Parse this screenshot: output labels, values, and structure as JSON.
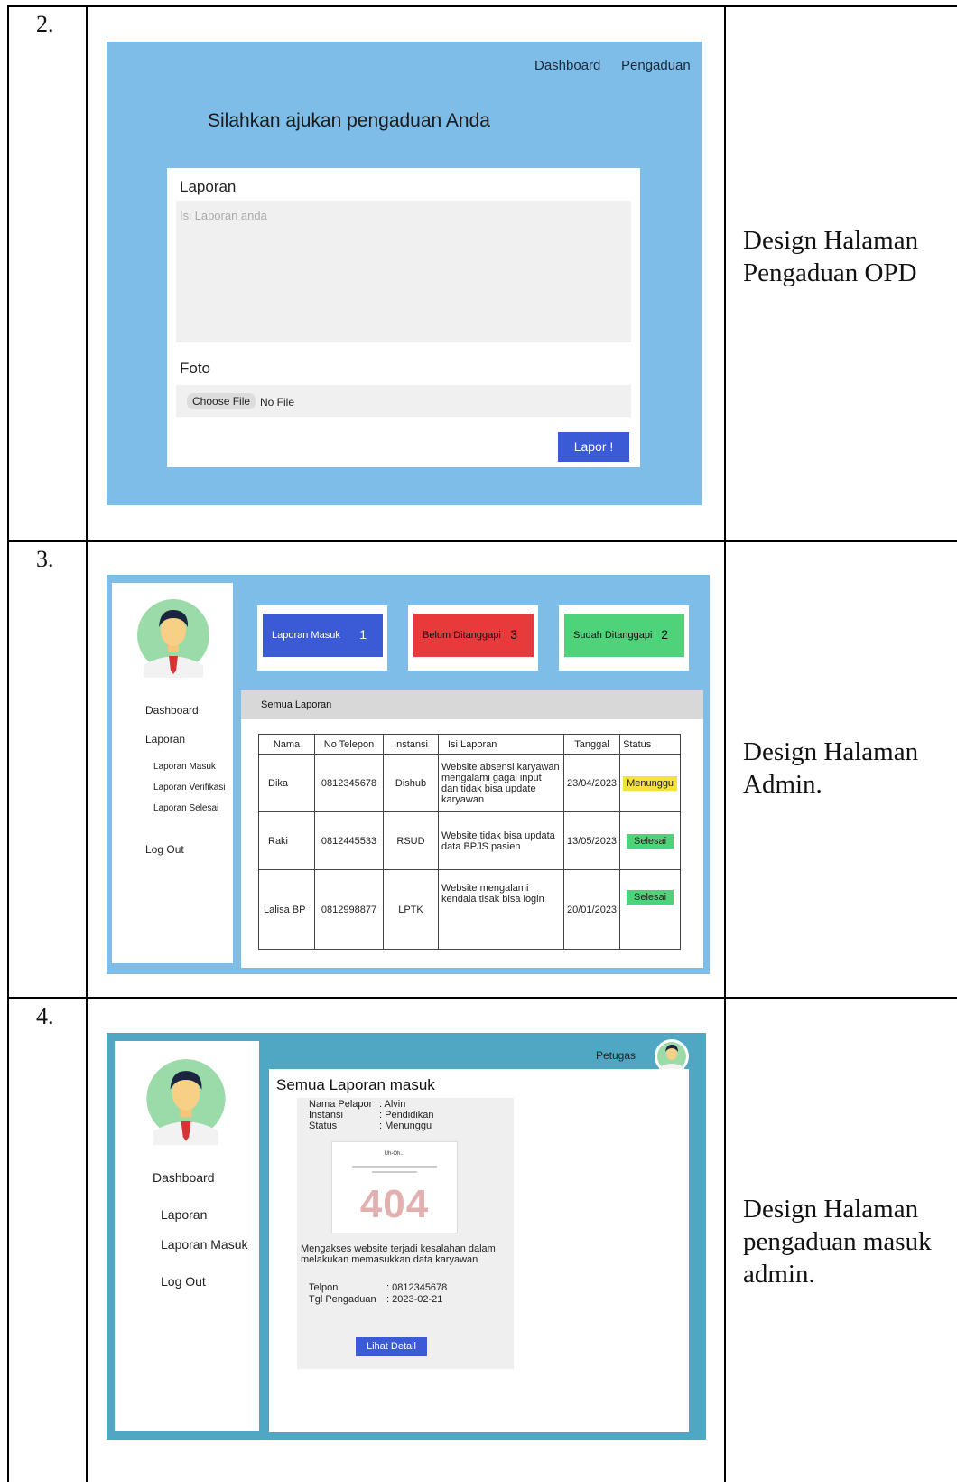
{
  "rows": [
    {
      "number": "2.",
      "description": "Design Halaman Pengaduan OPD"
    },
    {
      "number": "3.",
      "description": "Design Halaman Admin."
    },
    {
      "number": "4.",
      "description": "Design Halaman pengaduan masuk admin."
    }
  ],
  "mockup_pengaduan": {
    "nav": [
      "Dashboard",
      "Pengaduan"
    ],
    "heading": "Silahkan ajukan pengaduan Anda",
    "laporan_label": "Laporan",
    "laporan_placeholder": "Isi Laporan anda",
    "foto_label": "Foto",
    "choose_file": "Choose File",
    "no_file": "No File",
    "submit": "Lapor !"
  },
  "mockup_admin": {
    "sidebar": {
      "dashboard": "Dashboard",
      "laporan": "Laporan",
      "sub": [
        "Laporan Masuk",
        "Laporan Verifikasi",
        "Laporan Selesai"
      ],
      "logout": "Log Out"
    },
    "stats": [
      {
        "label": "Laporan Masuk",
        "count": "1",
        "color": "#3b5ad6"
      },
      {
        "label": "Belum Ditanggapi",
        "count": "3",
        "color": "#e83a3a"
      },
      {
        "label": "Sudah Ditanggapi",
        "count": "2",
        "color": "#4fd37a"
      }
    ],
    "panel_title": "Semua Laporan",
    "table": {
      "headers": [
        "Nama",
        "No Telepon",
        "Instansi",
        "Isi Laporan",
        "Tanggal",
        "Status"
      ],
      "rows": [
        {
          "nama": "Dika",
          "telepon": "0812345678",
          "instansi": "Dishub",
          "isi": "Website absensi karyawan mengalami gagal input dan tidak bisa update karyawan",
          "tanggal": "23/04/2023",
          "status": "Menunggu",
          "status_color": "#f5e23a"
        },
        {
          "nama": "Raki",
          "telepon": "0812445533",
          "instansi": "RSUD",
          "isi": "Website tidak bisa updata data BPJS pasien",
          "tanggal": "13/05/2023",
          "status": "Selesai",
          "status_color": "#4fd37a"
        },
        {
          "nama": "Lalisa BP",
          "telepon": "0812998877",
          "instansi": "LPTK",
          "isi": "Website mengalami kendala tisak bisa login",
          "tanggal": "20/01/2023",
          "status": "Selesai",
          "status_color": "#4fd37a"
        }
      ]
    }
  },
  "mockup_masuk": {
    "user_label": "Petugas",
    "sidebar": {
      "dashboard": "Dashboard",
      "laporan": "Laporan",
      "laporan_masuk": "Laporan Masuk",
      "logout": "Log Out"
    },
    "title": "Semua Laporan masuk",
    "fields": [
      {
        "key": "Nama Pelapor",
        "value": ": Alvin"
      },
      {
        "key": "Instansi",
        "value": ": Pendidikan"
      },
      {
        "key": "Status",
        "value": ": Menunggu"
      }
    ],
    "screenshot": {
      "heading": "Uh-Oh...",
      "code": "404"
    },
    "message": "Mengakses website terjadi kesalahan dalam melakukan memasukkan data karyawan",
    "contact": [
      {
        "key": "Telpon",
        "value": ": 0812345678"
      },
      {
        "key": "Tgl Pengaduan",
        "value": ": 2023-02-21"
      }
    ],
    "button": "Lihat Detail"
  }
}
